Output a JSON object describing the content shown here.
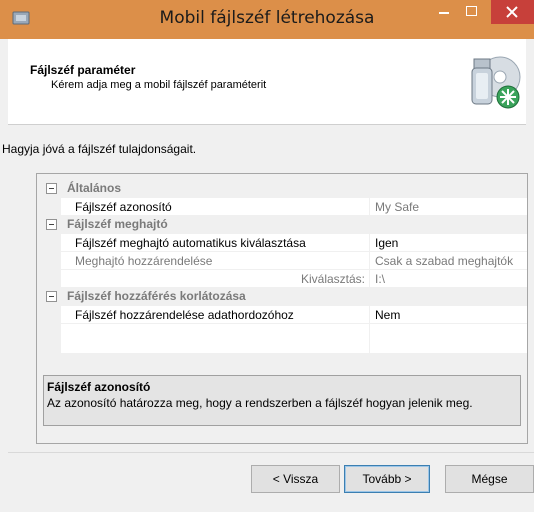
{
  "window": {
    "title": "Mobil fájlszéf létrehozása",
    "titlebar_color": "#dc8f49",
    "close_color": "#c7403a"
  },
  "header": {
    "title": "Fájlszéf paraméter",
    "subtitle": "Kérem adja meg a mobil fájlszéf paraméterit"
  },
  "prompt": "Hagyja jóvá a fájlszéf tulajdonságait.",
  "property_grid": {
    "categories": [
      {
        "label": "Általános",
        "expanded": true,
        "properties": [
          {
            "name": "Fájlszéf azonosító",
            "value": "My Safe",
            "value_disabled": true
          }
        ]
      },
      {
        "label": "Fájlszéf meghajtó",
        "expanded": true,
        "properties": [
          {
            "name": "Fájlszéf meghajtó automatikus kiválasztása",
            "value": "Igen"
          },
          {
            "name": "Meghajtó hozzárendelése",
            "value": "Csak a szabad meghajtók",
            "name_disabled": true,
            "value_disabled": true
          },
          {
            "name": "Kiválasztás:",
            "value": "I:\\",
            "name_disabled": true,
            "value_disabled": true
          }
        ]
      },
      {
        "label": "Fájlszéf hozzáférés korlátozása",
        "expanded": true,
        "properties": [
          {
            "name": "Fájlszéf hozzárendelése adathordozóhoz",
            "value": "Nem"
          }
        ]
      }
    ]
  },
  "description": {
    "title": "Fájlszéf azonosító",
    "text": "Az azonosító határozza meg, hogy a rendszerben a fájlszéf hogyan jelenik meg."
  },
  "buttons": {
    "back": "< Vissza",
    "next": "Tovább >",
    "cancel": "Mégse"
  }
}
